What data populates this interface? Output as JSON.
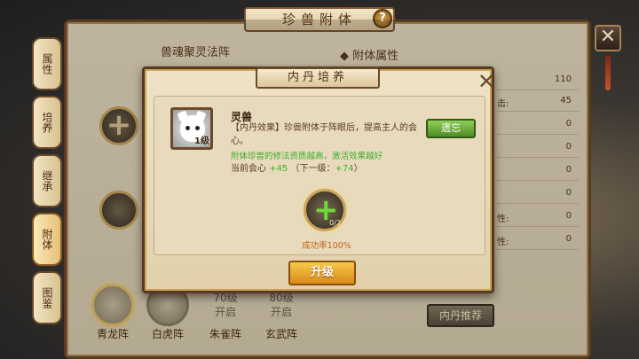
{
  "main": {
    "title": "珍兽附体",
    "help_icon": "?",
    "close_icon": "✕",
    "left_section_title": "兽魂聚灵法阵",
    "right_section_title": "附体属性",
    "attr_values": [
      "110",
      "45",
      "0",
      "0",
      "0",
      "0",
      "0",
      "0"
    ],
    "attr_keys": [
      "",
      "击:",
      "",
      "",
      "",
      "",
      "性:",
      "性:"
    ]
  },
  "side_tabs": [
    {
      "label": "属性",
      "active": false
    },
    {
      "label": "培养",
      "active": false
    },
    {
      "label": "继承",
      "active": false
    },
    {
      "label": "附体",
      "active": true
    },
    {
      "label": "图鉴",
      "active": false
    }
  ],
  "formations": [
    {
      "label": "青龙阵",
      "lock": ""
    },
    {
      "label": "白虎阵",
      "lock": ""
    },
    {
      "label": "朱雀阵",
      "lock": "70级\n开启"
    },
    {
      "label": "玄武阵",
      "lock": "80级\n开启"
    }
  ],
  "recommend_button": "内丹推荐",
  "modal": {
    "title": "内丹培养",
    "close_icon": "✕",
    "pet_name": "灵兽",
    "pet_level": "1级",
    "effect_text": "【内丹效果】珍兽附体于阵眼后，提高主人的会心。",
    "green_tip": "附体珍兽的修法资质越高，激活效果越好",
    "current_label": "当前会心",
    "current_value": "+45",
    "next_label": "（下一级：",
    "next_value": "+74",
    "next_close": "）",
    "forget_button": "遗忘",
    "danyao_plus": "+",
    "danyao_count": "0/2",
    "success_rate": "成功率100%",
    "upgrade_button": "升级"
  }
}
